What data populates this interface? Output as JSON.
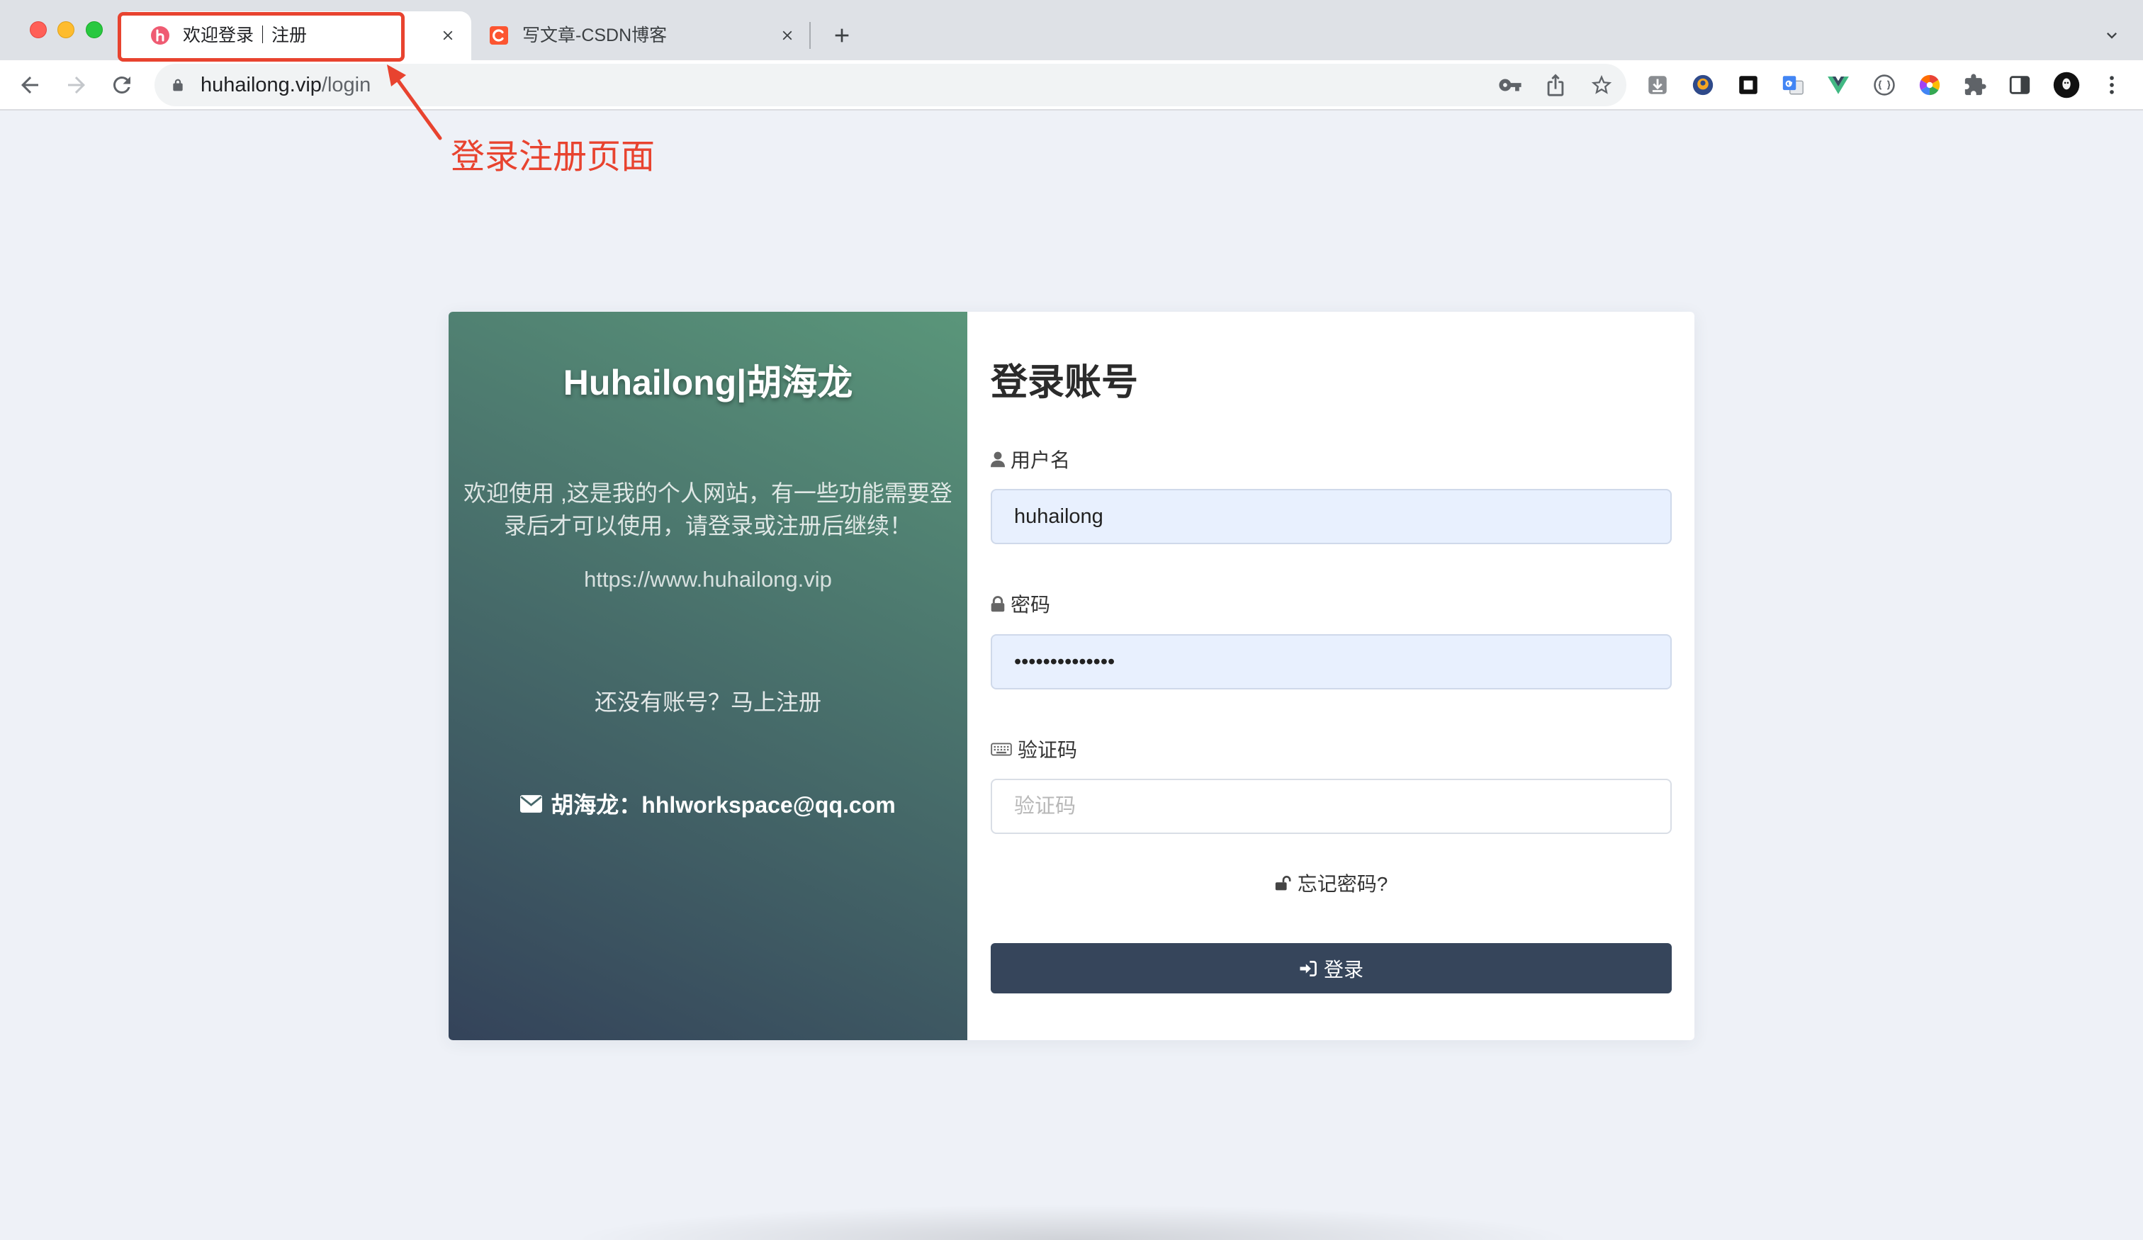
{
  "browser": {
    "tabs": [
      {
        "title": "欢迎登录｜注册",
        "active": true,
        "favicon": "site-favicon"
      },
      {
        "title": "写文章-CSDN博客",
        "active": false,
        "favicon": "csdn-favicon"
      }
    ],
    "address": {
      "host": "huhailong.vip",
      "path": "/login"
    },
    "toolbar_icons": [
      "back-icon",
      "forward-icon",
      "reload-icon",
      "lock-icon",
      "key-icon",
      "share-icon",
      "star-icon"
    ],
    "extension_icons": [
      "download-extension-icon",
      "circle-extension-icon",
      "square-extension-icon",
      "translate-extension-icon",
      "vue-devtools-icon",
      "braces-extension-icon",
      "color-wheel-extension-icon",
      "puzzle-icon",
      "side-panel-icon",
      "profile-avatar",
      "more-menu-icon"
    ]
  },
  "annotation": {
    "text": "登录注册页面"
  },
  "left_panel": {
    "title": "Huhailong|胡海龙",
    "intro": "欢迎使用 ,这是我的个人网站，有一些功能需要登录后才可以使用，请登录或注册后继续！",
    "website": "https://www.huhailong.vip",
    "register_prompt": "还没有账号？马上注册",
    "contact": "胡海龙：hhlworkspace@qq.com"
  },
  "form": {
    "heading": "登录账号",
    "username_label": "用户名",
    "username_value": "huhailong",
    "password_label": "密码",
    "password_value": "••••••••••••••",
    "captcha_label": "验证码",
    "captcha_placeholder": "验证码",
    "forgot_password": "忘记密码?",
    "submit_label": "登录"
  },
  "colors": {
    "page_background": "#eef1f7",
    "annotation": "#e8432f",
    "panel_gradient_start": "#34435a",
    "panel_gradient_end": "#5a967a",
    "button": "#36455b",
    "autofill": "#e8f0fe"
  }
}
